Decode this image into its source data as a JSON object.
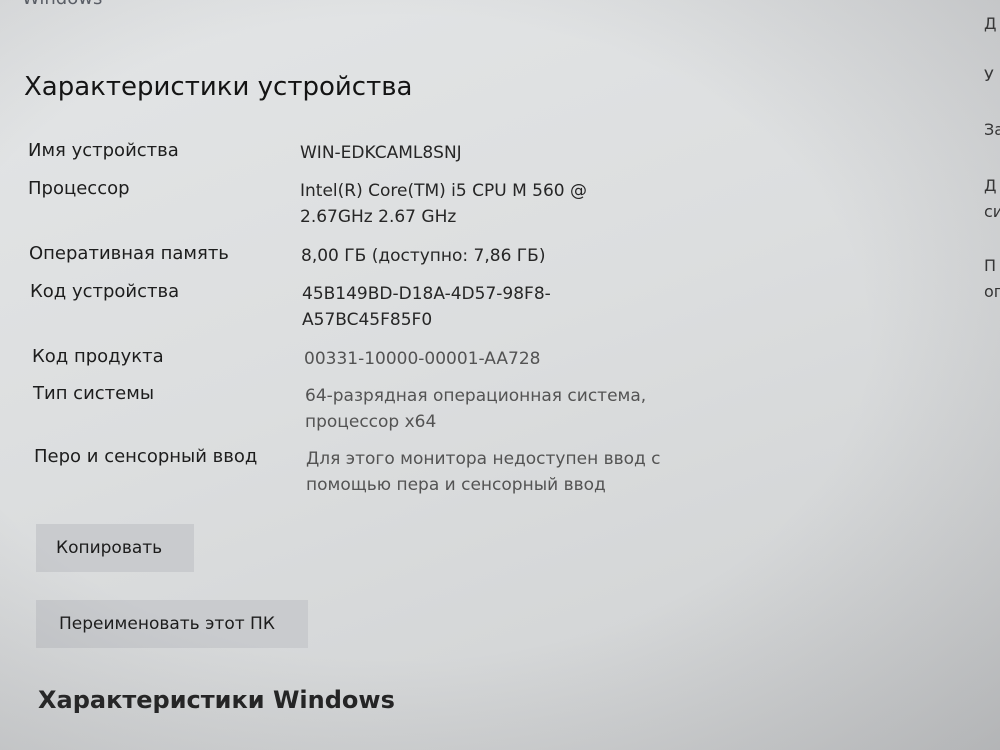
{
  "window": {
    "top_cut_text": "Windows"
  },
  "device_specs": {
    "title": "Характеристики устройства",
    "rows": [
      {
        "label": "Имя устройства",
        "value": "WIN-EDKCAML8SNJ"
      },
      {
        "label": "Процессор",
        "value": "Intel(R) Core(TM) i5 CPU       M 560  @\n2.67GHz   2.67 GHz"
      },
      {
        "label": "Оперативная память",
        "value": "8,00 ГБ (доступно: 7,86 ГБ)"
      },
      {
        "label": "Код устройства",
        "value": "45B149BD-D18A-4D57-98F8-\nA57BC45F85F0"
      },
      {
        "label": "Код продукта",
        "value": "00331-10000-00001-AA728"
      },
      {
        "label": "Тип системы",
        "value": "64-разрядная операционная система,\nпроцессор x64"
      },
      {
        "label": "Перо и сенсорный ввод",
        "value": "Для этого монитора недоступен ввод с\nпомощью пера и сенсорный ввод"
      }
    ],
    "copy_button": "Копировать",
    "rename_button": "Переименовать этот ПК"
  },
  "windows_specs": {
    "title": "Характеристики Windows"
  },
  "right_panel": {
    "fragments": [
      "Д",
      "У",
      "За",
      "Д",
      "си",
      "П",
      "ог"
    ]
  }
}
